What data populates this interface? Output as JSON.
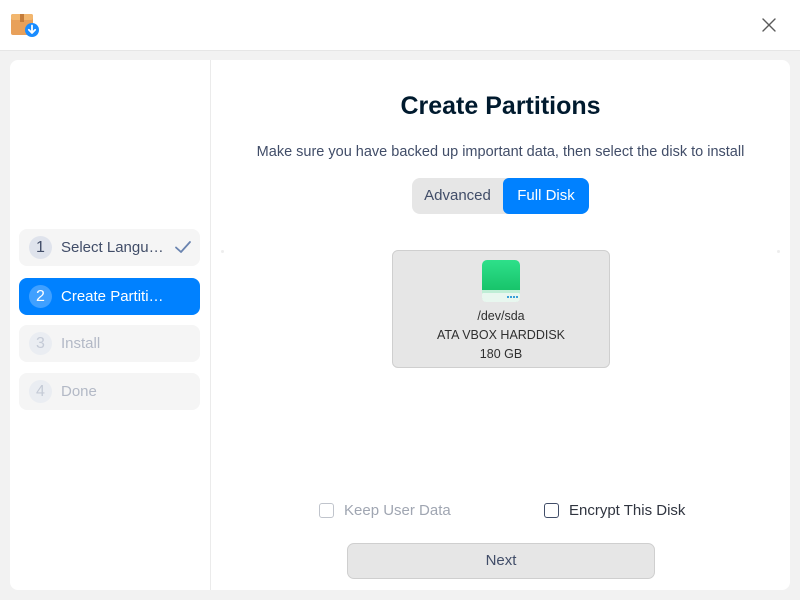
{
  "titlebar": {
    "app_icon": "package-download-icon",
    "close_icon": "close-icon"
  },
  "sidebar": {
    "steps": [
      {
        "number": "1",
        "label": "Select Langua…",
        "state": "done",
        "icon": "checkmark-icon"
      },
      {
        "number": "2",
        "label": "Create Partiti…",
        "state": "active"
      },
      {
        "number": "3",
        "label": "Install",
        "state": "disabled"
      },
      {
        "number": "4",
        "label": "Done",
        "state": "disabled"
      }
    ]
  },
  "main": {
    "title": "Create Partitions",
    "subtitle": "Make sure you have backed up important data, then select the disk to install",
    "mode_switch": {
      "advanced_label": "Advanced",
      "full_disk_label": "Full Disk",
      "selected": "Full Disk"
    },
    "disk": {
      "icon": "hard-disk-icon",
      "device": "/dev/sda",
      "model": "ATA VBOX HARDDISK",
      "size": "180 GB"
    },
    "options": {
      "keep_user_data_label": "Keep User Data",
      "encrypt_disk_label": "Encrypt This Disk"
    },
    "next_label": "Next"
  },
  "colors": {
    "accent": "#0081ff",
    "disk_green": "#1dc971"
  }
}
